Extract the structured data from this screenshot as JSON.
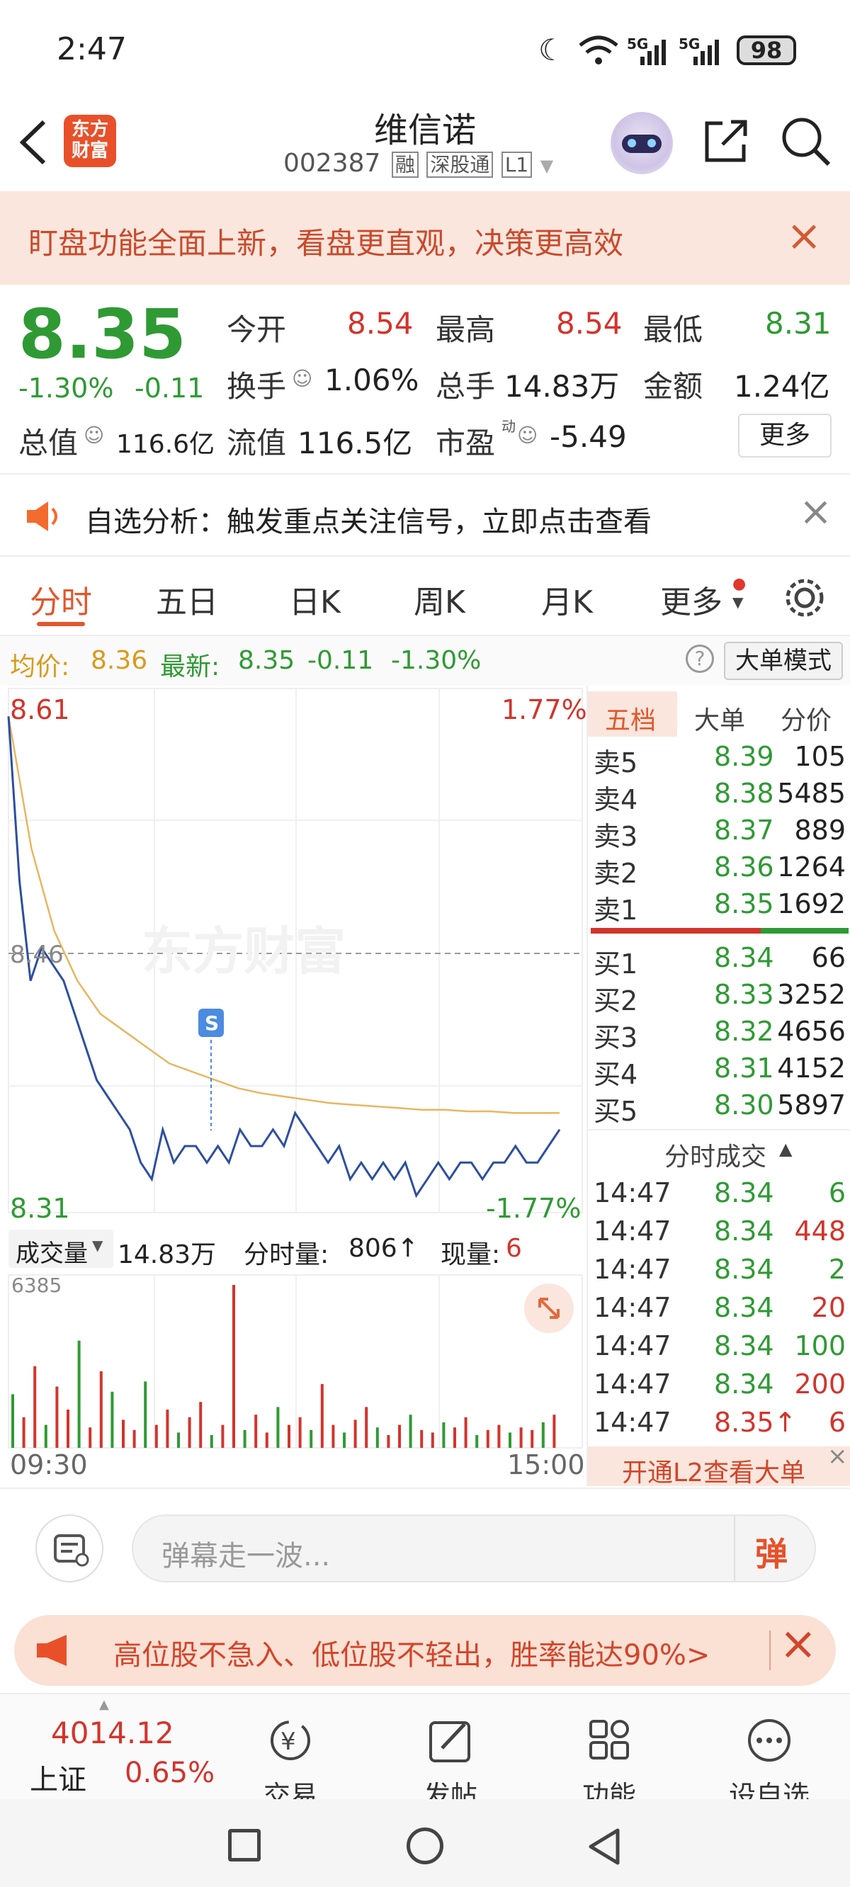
{
  "status": {
    "time": "2:47",
    "battery": "98",
    "signal1": "5G",
    "signal2": "5G"
  },
  "header": {
    "title": "维信诺",
    "code": "002387",
    "badge1": "融",
    "badge2": "深股通",
    "badge3": "L1",
    "logo": "东方\n财富"
  },
  "banner": {
    "text": "盯盘功能全面上新，看盘更直观，决策更高效"
  },
  "quote": {
    "price": "8.35",
    "change_pct": "-1.30%",
    "change": "-0.11",
    "open_label": "今开",
    "open": "8.54",
    "high_label": "最高",
    "high": "8.54",
    "low_label": "最低",
    "low": "8.31",
    "turnover_label": "换手",
    "turnover": "1.06%",
    "volume_label": "总手",
    "volume": "14.83万",
    "amount_label": "金额",
    "amount": "1.24亿",
    "mcap_label": "总值",
    "mcap": "116.6亿",
    "float_label": "流值",
    "float": "116.5亿",
    "pe_label": "市盈",
    "pe_sup": "动",
    "pe": "-5.49",
    "more": "更多"
  },
  "notice": {
    "text": "自选分析：触发重点关注信号，立即点击查看"
  },
  "tabs": [
    "分时",
    "五日",
    "日K",
    "周K",
    "月K",
    "更多"
  ],
  "avgline": {
    "avg_label": "均价:",
    "avg": "8.36",
    "last_label": "最新:",
    "last": "8.35",
    "chg": "-0.11",
    "pct": "-1.30%",
    "mode": "大单模式"
  },
  "chart": {
    "top_price": "8.61",
    "top_pct": "1.77%",
    "mid_price": "8.46",
    "low_price": "8.31",
    "low_pct": "-1.77%",
    "watermark": "东方财富",
    "marker": "S",
    "time_start": "09:30",
    "time_end": "15:00"
  },
  "volume": {
    "label": "成交量",
    "total": "14.83万",
    "tick_label": "分时量:",
    "tick": "806↑",
    "now_label": "现量:",
    "now": "6",
    "max": "6385"
  },
  "chart_data": {
    "type": "line",
    "ylim": [
      8.31,
      8.61
    ],
    "series": [
      {
        "values": [
          8.6,
          8.5,
          8.44,
          8.46,
          8.45,
          8.44,
          8.42,
          8.4,
          8.38,
          8.37,
          8.36,
          8.35,
          8.33,
          8.32,
          8.35,
          8.33,
          8.34,
          8.34,
          8.33,
          8.34,
          8.33,
          8.35,
          8.34,
          8.34,
          8.35,
          8.34,
          8.36,
          8.35,
          8.34,
          8.33,
          8.34,
          8.32,
          8.33,
          8.32,
          8.33,
          8.32,
          8.33,
          8.31,
          8.32,
          8.33,
          8.32,
          8.33,
          8.33,
          8.32,
          8.33,
          8.33,
          8.34,
          8.33,
          8.33,
          8.34,
          8.35
        ]
      },
      {
        "values": [
          8.6,
          8.52,
          8.47,
          8.44,
          8.42,
          8.41,
          8.4,
          8.39,
          8.385,
          8.38,
          8.375,
          8.372,
          8.37,
          8.368,
          8.366,
          8.365,
          8.364,
          8.363,
          8.362,
          8.362,
          8.361,
          8.361,
          8.36,
          8.36,
          8.36
        ]
      }
    ],
    "volume_values": [
      2100,
      1200,
      3200,
      900,
      2400,
      1500,
      4200,
      800,
      3000,
      2200,
      1100,
      700,
      2600,
      900,
      1500,
      600,
      1200,
      1800,
      500,
      900,
      6385,
      700,
      1300,
      600,
      1600,
      900,
      1200,
      700,
      2500,
      900,
      600,
      1100,
      1600,
      800,
      500,
      900,
      1300,
      700,
      600,
      1000,
      800,
      1200,
      500,
      700,
      900,
      600,
      800,
      700,
      1000,
      1300
    ]
  },
  "book": {
    "tabs": [
      "五档",
      "大单",
      "分价"
    ],
    "sells": [
      {
        "label": "卖5",
        "price": "8.39",
        "vol": "105"
      },
      {
        "label": "卖4",
        "price": "8.38",
        "vol": "5485"
      },
      {
        "label": "卖3",
        "price": "8.37",
        "vol": "889"
      },
      {
        "label": "卖2",
        "price": "8.36",
        "vol": "1264"
      },
      {
        "label": "卖1",
        "price": "8.35",
        "vol": "1692"
      }
    ],
    "buys": [
      {
        "label": "买1",
        "price": "8.34",
        "vol": "66"
      },
      {
        "label": "买2",
        "price": "8.33",
        "vol": "3252"
      },
      {
        "label": "买3",
        "price": "8.32",
        "vol": "4656"
      },
      {
        "label": "买4",
        "price": "8.31",
        "vol": "4152"
      },
      {
        "label": "买5",
        "price": "8.30",
        "vol": "5897"
      }
    ],
    "trades_title": "分时成交",
    "trades": [
      {
        "time": "14:47",
        "price": "8.34",
        "vol": "6"
      },
      {
        "time": "14:47",
        "price": "8.34",
        "vol": "448"
      },
      {
        "time": "14:47",
        "price": "8.34",
        "vol": "2"
      },
      {
        "time": "14:47",
        "price": "8.34",
        "vol": "20"
      },
      {
        "time": "14:47",
        "price": "8.34",
        "vol": "100"
      },
      {
        "time": "14:47",
        "price": "8.34",
        "vol": "200"
      },
      {
        "time": "14:47",
        "price": "8.35↑",
        "vol": "6"
      }
    ],
    "l2": "开通L2查看大单"
  },
  "danmaku": {
    "placeholder": "弹幕走一波...",
    "send": "弹"
  },
  "ad": {
    "text": "高位股不急入、低位股不轻出，胜率能达90%>"
  },
  "bottom": {
    "index_value": "4014.12",
    "index_name": "上证",
    "index_pct": "0.65%",
    "trade": "交易",
    "post": "发帖",
    "func": "功能",
    "watch": "设自选"
  }
}
